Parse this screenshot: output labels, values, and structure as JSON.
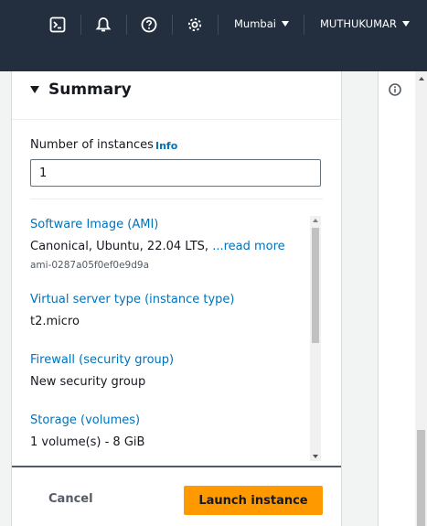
{
  "topbar": {
    "icons": [
      "cloudshell-icon",
      "notifications-bell-icon",
      "help-icon",
      "settings-gear-icon"
    ],
    "region": "Mumbai",
    "account": "MUTHUKUMAR"
  },
  "summary": {
    "title": "Summary",
    "instances": {
      "label": "Number of instances",
      "info": "Info",
      "value": "1"
    },
    "details": [
      {
        "label": "Software Image (AMI)",
        "value": "Canonical, Ubuntu, 22.04 LTS, ",
        "more": "...read more",
        "sub": "ami-0287a05f0ef0e9d9a"
      },
      {
        "label": "Virtual server type (instance type)",
        "value": "t2.micro"
      },
      {
        "label": "Firewall (security group)",
        "value": "New security group"
      },
      {
        "label": "Storage (volumes)",
        "value": "1 volume(s) - 8 GiB"
      }
    ],
    "cancel": "Cancel",
    "launch": "Launch instance"
  },
  "colors": {
    "topbar": "#232f3e",
    "link": "#0073bb",
    "primary_button": "#ff9900"
  }
}
